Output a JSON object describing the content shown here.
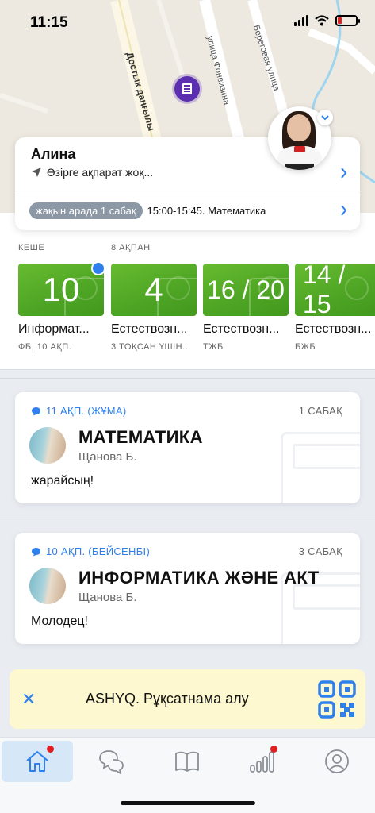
{
  "status_bar": {
    "time": "11:15"
  },
  "map": {
    "streets": [
      "Достык даңғылы",
      "улица Фонвизина",
      "Береговая улица"
    ]
  },
  "profile": {
    "name": "Алина",
    "location_text": "Әзірге ақпарат жоқ...",
    "upcoming_badge": "жақын арада 1 сабақ",
    "upcoming_lesson": "15:00-15:45. Математика"
  },
  "grades": {
    "headers": [
      "КЕШЕ",
      "8 АҚПАН"
    ],
    "tiles": [
      {
        "value": "10",
        "title": "Информат...",
        "sub": "ФБ,  10 АҚП.",
        "new": true
      },
      {
        "value": "4",
        "title": "Естествозн...",
        "sub": "3 ТОҚСАН ҮШІН...",
        "new": false
      },
      {
        "value": "16 / 20",
        "title": "Естествозн...",
        "sub": "ТЖБ",
        "new": false
      },
      {
        "value": "14 / 15",
        "title": "Естествозн...",
        "sub": "БЖБ",
        "new": false
      }
    ]
  },
  "feed": [
    {
      "date": "11 АҚП. (ЖҰМА)",
      "lesson": "1 САБАҚ",
      "subject": "МАТЕМАТИКА",
      "teacher": "Щанова Б.",
      "message": "жарайсың!"
    },
    {
      "date": "10 АҚП. (БЕЙСЕНБІ)",
      "lesson": "3 САБАҚ",
      "subject": "ИНФОРМАТИКА ЖӘНЕ АКТ",
      "teacher": "Щанова Б.",
      "message": "Молодец!"
    }
  ],
  "ashyq": {
    "text": "ASHYQ. Рұқсатнама алу"
  },
  "tabs": [
    {
      "icon": "home-icon",
      "active": true,
      "badge": true
    },
    {
      "icon": "chat-icon",
      "active": false,
      "badge": false
    },
    {
      "icon": "book-icon",
      "active": false,
      "badge": false
    },
    {
      "icon": "stats-icon",
      "active": false,
      "badge": true
    },
    {
      "icon": "profile-icon",
      "active": false,
      "badge": false
    }
  ],
  "colors": {
    "accent": "#2f80ed",
    "grade_green": "#4ea524",
    "pin": "#5b2fb0",
    "banner": "#fdf8cf"
  }
}
